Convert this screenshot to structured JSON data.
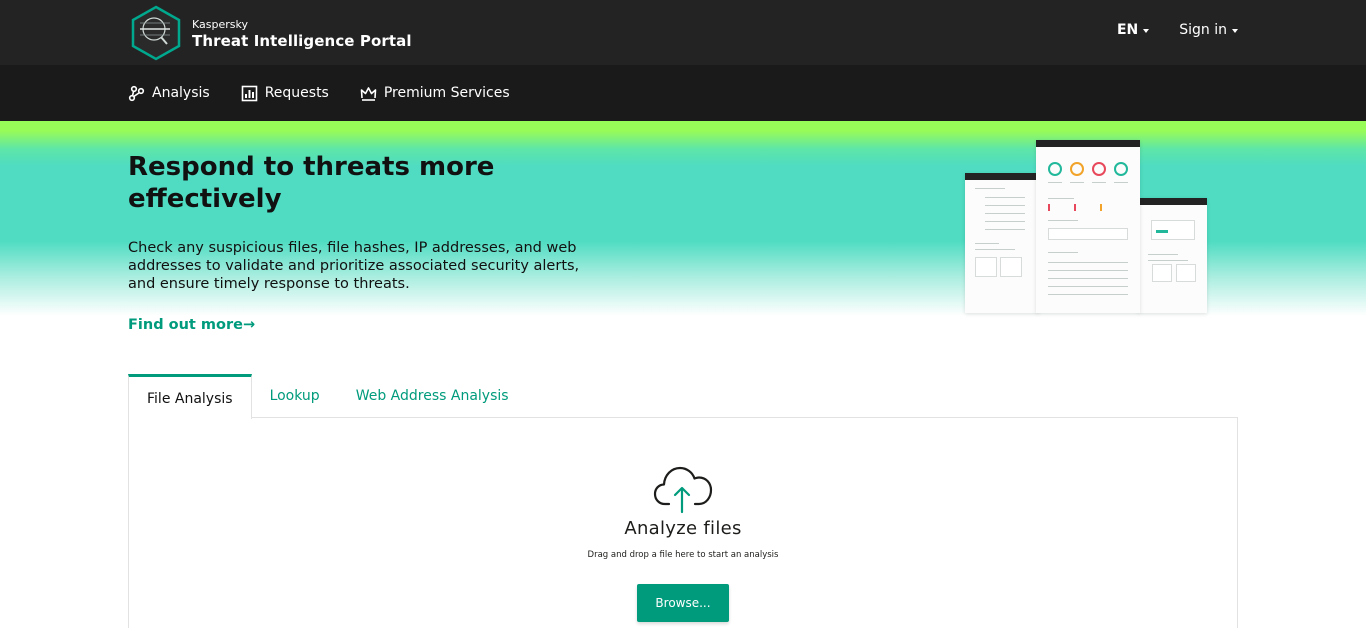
{
  "header": {
    "brand": "Kaspersky",
    "product": "Threat Intelligence Portal",
    "language": "EN",
    "sign_in": "Sign in"
  },
  "nav": {
    "items": [
      {
        "label": "Analysis",
        "icon": "analysis-nodes-icon"
      },
      {
        "label": "Requests",
        "icon": "bar-chart-icon"
      },
      {
        "label": "Premium Services",
        "icon": "crown-icon"
      }
    ]
  },
  "hero": {
    "title": "Respond to threats more effectively",
    "description": "Check any suspicious files, file hashes, IP addresses, and web addresses to validate and prioritize associated security alerts, and ensure timely response to threats.",
    "link": "Find out more"
  },
  "tabs": [
    {
      "label": "File Analysis",
      "active": true
    },
    {
      "label": "Lookup",
      "active": false
    },
    {
      "label": "Web Address Analysis",
      "active": false
    }
  ],
  "upload": {
    "icon": "cloud-upload-icon",
    "title": "Analyze files",
    "subtitle": "Drag and drop a file here to start an analysis",
    "button": "Browse..."
  },
  "colors": {
    "accent": "#009b7c",
    "header_bg": "#232323",
    "hero_green": "#97fb58",
    "hero_teal": "#4fdcc2"
  }
}
